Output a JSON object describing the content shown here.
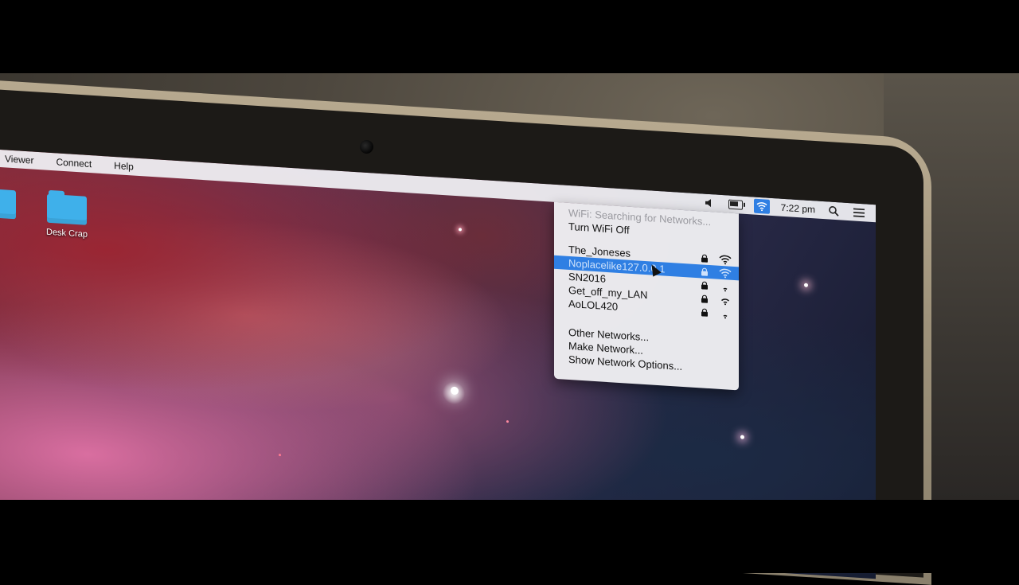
{
  "menubar": {
    "items": [
      "Viewer",
      "Connect",
      "Help"
    ],
    "clock": "7:22 pm"
  },
  "desktop": {
    "icons": [
      {
        "label": "Desk Crap"
      }
    ]
  },
  "wifi_menu": {
    "status": "WiFi: Searching for Networks...",
    "toggle": "Turn WiFi Off",
    "networks": [
      {
        "name": "The_Joneses",
        "locked": true,
        "signal": 3,
        "selected": false
      },
      {
        "name": "Noplacelike127.0.0.1",
        "locked": true,
        "signal": 3,
        "selected": true
      },
      {
        "name": "SN2016",
        "locked": true,
        "signal": 1,
        "selected": false
      },
      {
        "name": "Get_off_my_LAN",
        "locked": true,
        "signal": 2,
        "selected": false
      },
      {
        "name": "AoLOL420",
        "locked": true,
        "signal": 1,
        "selected": false
      }
    ],
    "other": "Other Networks...",
    "make": "Make Network...",
    "options": "Show Network Options..."
  },
  "colors": {
    "accent": "#2f7fe3",
    "menubar": "#eeeef2",
    "folder": "#3fb0ea"
  },
  "icons": [
    "volume-icon",
    "battery-icon",
    "wifi-icon",
    "search-icon",
    "list-icon",
    "lock-icon",
    "signal-icon",
    "folder-icon"
  ]
}
